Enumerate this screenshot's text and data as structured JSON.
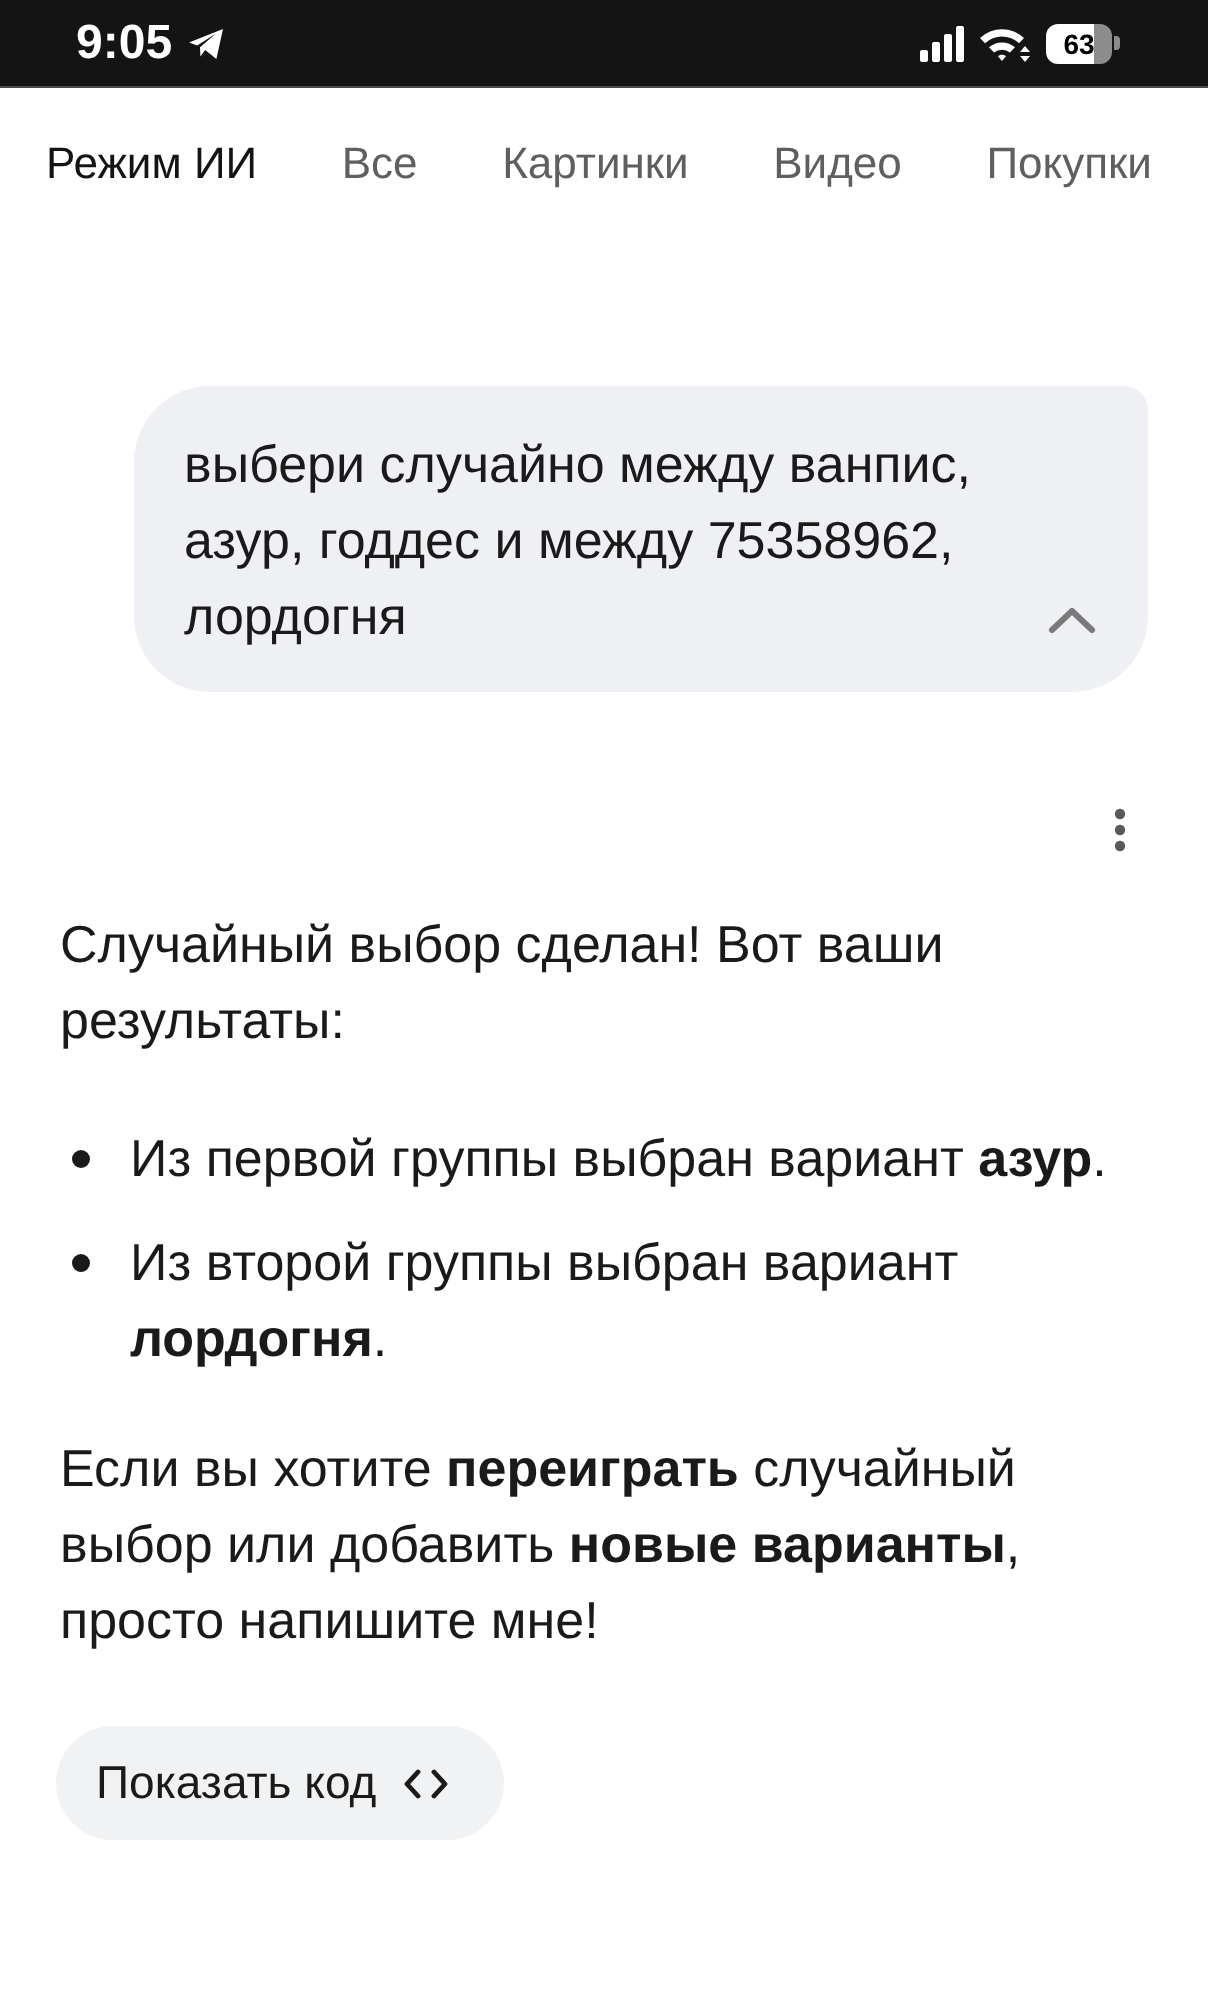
{
  "status_bar": {
    "time": "9:05",
    "battery": "63"
  },
  "tabs": [
    {
      "label": "Режим ИИ",
      "selected": true
    },
    {
      "label": "Все",
      "selected": false
    },
    {
      "label": "Картинки",
      "selected": false
    },
    {
      "label": "Видео",
      "selected": false
    },
    {
      "label": "Покупки",
      "selected": false
    }
  ],
  "user_message": {
    "text": "выбери случайно между ванпис, азур, годдес и между 75358962, лордогня",
    "expanded": true
  },
  "response": {
    "intro": "Случайный выбор сделан! Вот ваши результаты:",
    "bullets": [
      "Из первой группы выбран вариант **азур**.",
      "Из второй группы выбран вариант **лордогня**."
    ],
    "closing": "Если вы хотите **переиграть** случайный выбор или добавить **новые варианты**, просто напишите мне!"
  },
  "show_code_button": {
    "label": "Показать код"
  }
}
